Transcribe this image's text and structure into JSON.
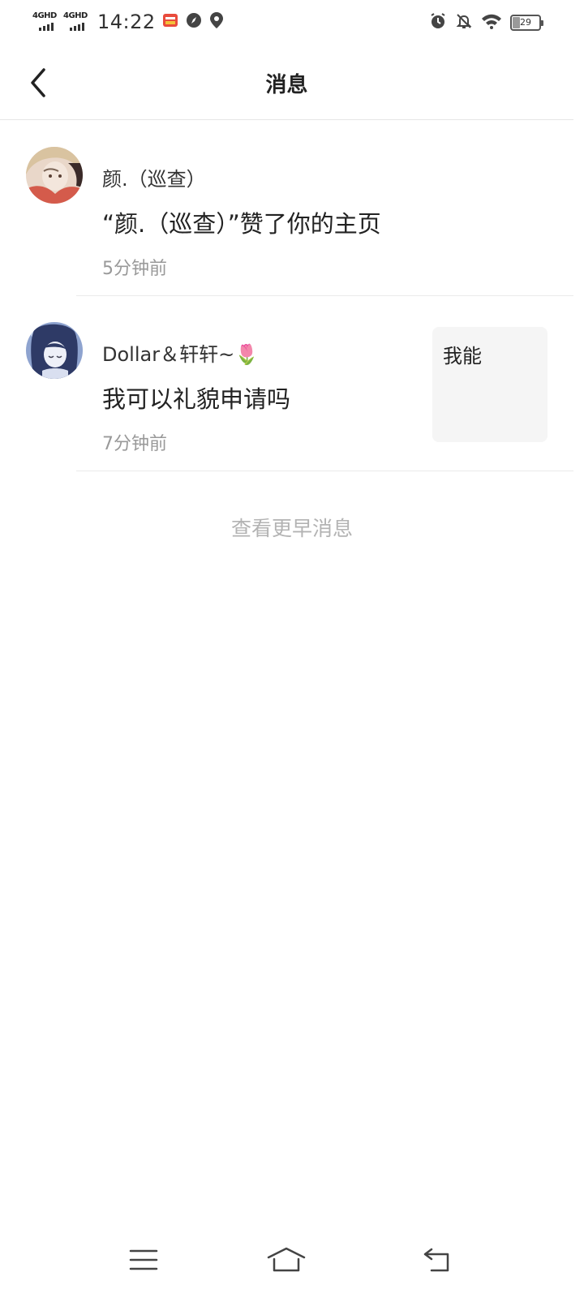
{
  "status_bar": {
    "network_1": "4GHD",
    "network_2": "4GHD",
    "time": "14:22",
    "battery": "29",
    "battery_level": 0.29,
    "icons": [
      "app-notification-icon",
      "compass-icon",
      "location-icon",
      "alarm-icon",
      "mute-bell-icon",
      "wifi-icon",
      "battery-icon"
    ]
  },
  "header": {
    "title": "消息",
    "back_icon": "chevron-left-icon"
  },
  "messages": [
    {
      "sender": "颜.（巡查）",
      "content": "“颜.（巡查）”赞了你的主页",
      "time": "5分钟前"
    },
    {
      "sender": "Dollar＆轩轩~🌷",
      "content": "我可以礼貌申请吗",
      "time": "7分钟前",
      "preview": "我能"
    }
  ],
  "load_older": "查看更早消息",
  "nav_bar": {
    "icons": [
      "menu-icon",
      "home-icon",
      "back-icon"
    ]
  }
}
